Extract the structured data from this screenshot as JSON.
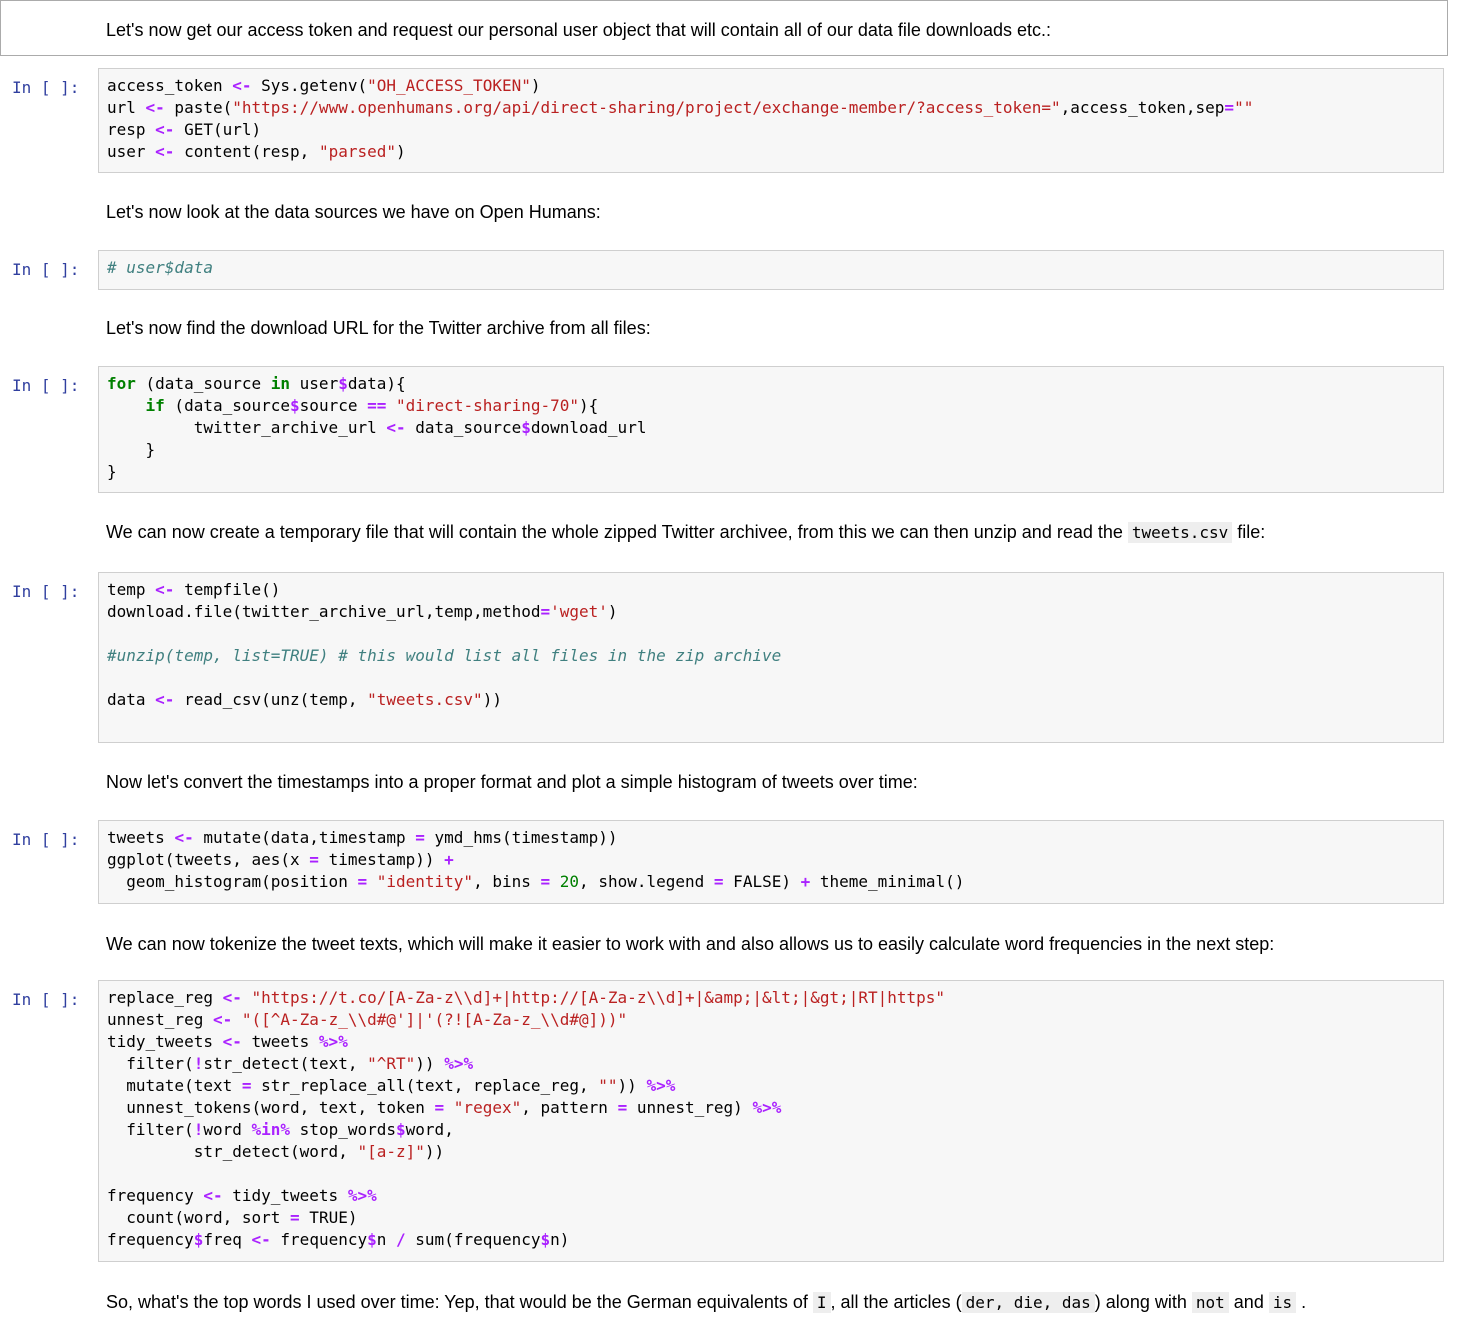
{
  "prompt": "In [ ]:",
  "markdown": {
    "m1": "Let's now get our access token and request our personal user object that will contain all of our data file downloads etc.:",
    "m2": "Let's now look at the data sources we have on Open Humans:",
    "m3": "Let's now find the download URL for the Twitter archive from all files:",
    "m4_a": "We can now create a temporary file that will contain the whole zipped Twitter archivee, from this we can then unzip and read the",
    "m4_code": "tweets.csv",
    "m4_b": "file:",
    "m5": "Now let's convert the timestamps into a proper format and plot a simple histogram of tweets over time:",
    "m6": "We can now tokenize the tweet texts, which will make it easier to work with and also allows us to easily calculate word frequencies in the next step:",
    "m7_a": "So, what's the top words I used over time: Yep, that would be the German equivalents of",
    "m7_c1": "I",
    "m7_b": ", all the articles (",
    "m7_c2": "der, die, das",
    "m7_c": ") along with",
    "m7_c3": "not",
    "m7_d": "and",
    "m7_c4": "is",
    "m7_e": "."
  },
  "cells": [
    {
      "name": "access-token-cell",
      "lines": [
        [
          [
            "t",
            "access_token "
          ],
          [
            "o",
            "<-"
          ],
          [
            "t",
            " Sys.getenv("
          ],
          [
            "s",
            "\"OH_ACCESS_TOKEN\""
          ],
          [
            "t",
            ")"
          ]
        ],
        [
          [
            "t",
            "url "
          ],
          [
            "o",
            "<-"
          ],
          [
            "t",
            " paste("
          ],
          [
            "s",
            "\"https://www.openhumans.org/api/direct-sharing/project/exchange-member/?access_token=\""
          ],
          [
            "t",
            ",access_token,sep"
          ],
          [
            "o",
            "="
          ],
          [
            "s",
            "\"\""
          ]
        ],
        [
          [
            "t",
            "resp "
          ],
          [
            "o",
            "<-"
          ],
          [
            "t",
            " GET(url)"
          ]
        ],
        [
          [
            "t",
            "user "
          ],
          [
            "o",
            "<-"
          ],
          [
            "t",
            " content(resp, "
          ],
          [
            "s",
            "\"parsed\""
          ],
          [
            "t",
            ")"
          ]
        ]
      ]
    },
    {
      "name": "user-data-cell",
      "lines": [
        [
          [
            "c",
            "# user$data"
          ]
        ]
      ]
    },
    {
      "name": "for-loop-cell",
      "lines": [
        [
          [
            "k",
            "for"
          ],
          [
            "t",
            " (data_source "
          ],
          [
            "k",
            "in"
          ],
          [
            "t",
            " user"
          ],
          [
            "o",
            "$"
          ],
          [
            "t",
            "data){"
          ]
        ],
        [
          [
            "t",
            "    "
          ],
          [
            "k",
            "if"
          ],
          [
            "t",
            " (data_source"
          ],
          [
            "o",
            "$"
          ],
          [
            "t",
            "source "
          ],
          [
            "o",
            "=="
          ],
          [
            "t",
            " "
          ],
          [
            "s",
            "\"direct-sharing-70\""
          ],
          [
            "t",
            "){"
          ]
        ],
        [
          [
            "t",
            "         twitter_archive_url "
          ],
          [
            "o",
            "<-"
          ],
          [
            "t",
            " data_source"
          ],
          [
            "o",
            "$"
          ],
          [
            "t",
            "download_url"
          ]
        ],
        [
          [
            "t",
            "    }"
          ]
        ],
        [
          [
            "t",
            "}"
          ]
        ]
      ]
    },
    {
      "name": "tempfile-cell",
      "lines": [
        [
          [
            "t",
            "temp "
          ],
          [
            "o",
            "<-"
          ],
          [
            "t",
            " tempfile()"
          ]
        ],
        [
          [
            "t",
            "download.file(twitter_archive_url,temp,method"
          ],
          [
            "o",
            "="
          ],
          [
            "s",
            "'wget'"
          ],
          [
            "t",
            ")"
          ]
        ],
        [
          [
            "t",
            ""
          ]
        ],
        [
          [
            "c",
            "#unzip(temp, list=TRUE) # this would list all files in the zip archive"
          ]
        ],
        [
          [
            "t",
            ""
          ]
        ],
        [
          [
            "t",
            "data "
          ],
          [
            "o",
            "<-"
          ],
          [
            "t",
            " read_csv(unz(temp, "
          ],
          [
            "s",
            "\"tweets.csv\""
          ],
          [
            "t",
            "))"
          ]
        ],
        [
          [
            "t",
            ""
          ]
        ]
      ]
    },
    {
      "name": "histogram-cell",
      "lines": [
        [
          [
            "t",
            "tweets "
          ],
          [
            "o",
            "<-"
          ],
          [
            "t",
            " mutate(data,timestamp "
          ],
          [
            "o",
            "="
          ],
          [
            "t",
            " ymd_hms(timestamp))"
          ]
        ],
        [
          [
            "t",
            "ggplot(tweets, aes(x "
          ],
          [
            "o",
            "="
          ],
          [
            "t",
            " timestamp)) "
          ],
          [
            "o",
            "+"
          ]
        ],
        [
          [
            "t",
            "  geom_histogram(position "
          ],
          [
            "o",
            "="
          ],
          [
            "t",
            " "
          ],
          [
            "s",
            "\"identity\""
          ],
          [
            "t",
            ", bins "
          ],
          [
            "o",
            "="
          ],
          [
            "t",
            " "
          ],
          [
            "n",
            "20"
          ],
          [
            "t",
            ", show.legend "
          ],
          [
            "o",
            "="
          ],
          [
            "t",
            " FALSE) "
          ],
          [
            "o",
            "+"
          ],
          [
            "t",
            " theme_minimal()"
          ]
        ]
      ]
    },
    {
      "name": "tokenize-cell",
      "lines": [
        [
          [
            "t",
            "replace_reg "
          ],
          [
            "o",
            "<-"
          ],
          [
            "t",
            " "
          ],
          [
            "s",
            "\"https://t.co/[A-Za-z\\\\d]+|http://[A-Za-z\\\\d]+|&amp;|&lt;|&gt;|RT|https\""
          ]
        ],
        [
          [
            "t",
            "unnest_reg "
          ],
          [
            "o",
            "<-"
          ],
          [
            "t",
            " "
          ],
          [
            "s",
            "\"([^A-Za-z_\\\\d#@']|'(?![A-Za-z_\\\\d#@]))\""
          ]
        ],
        [
          [
            "t",
            "tidy_tweets "
          ],
          [
            "o",
            "<-"
          ],
          [
            "t",
            " tweets "
          ],
          [
            "o",
            "%>%"
          ]
        ],
        [
          [
            "t",
            "  filter("
          ],
          [
            "o",
            "!"
          ],
          [
            "t",
            "str_detect(text, "
          ],
          [
            "s",
            "\"^RT\""
          ],
          [
            "t",
            ")) "
          ],
          [
            "o",
            "%>%"
          ]
        ],
        [
          [
            "t",
            "  mutate(text "
          ],
          [
            "o",
            "="
          ],
          [
            "t",
            " str_replace_all(text, replace_reg, "
          ],
          [
            "s",
            "\"\""
          ],
          [
            "t",
            ")) "
          ],
          [
            "o",
            "%>%"
          ]
        ],
        [
          [
            "t",
            "  unnest_tokens(word, text, token "
          ],
          [
            "o",
            "="
          ],
          [
            "t",
            " "
          ],
          [
            "s",
            "\"regex\""
          ],
          [
            "t",
            ", pattern "
          ],
          [
            "o",
            "="
          ],
          [
            "t",
            " unnest_reg) "
          ],
          [
            "o",
            "%>%"
          ]
        ],
        [
          [
            "t",
            "  filter("
          ],
          [
            "o",
            "!"
          ],
          [
            "t",
            "word "
          ],
          [
            "o",
            "%in%"
          ],
          [
            "t",
            " stop_words"
          ],
          [
            "o",
            "$"
          ],
          [
            "t",
            "word,"
          ]
        ],
        [
          [
            "t",
            "         str_detect(word, "
          ],
          [
            "s",
            "\"[a-z]\""
          ],
          [
            "t",
            "))"
          ]
        ],
        [
          [
            "t",
            ""
          ]
        ],
        [
          [
            "t",
            "frequency "
          ],
          [
            "o",
            "<-"
          ],
          [
            "t",
            " tidy_tweets "
          ],
          [
            "o",
            "%>%"
          ]
        ],
        [
          [
            "t",
            "  count(word, sort "
          ],
          [
            "o",
            "="
          ],
          [
            "t",
            " TRUE)"
          ]
        ],
        [
          [
            "t",
            "frequency"
          ],
          [
            "o",
            "$"
          ],
          [
            "t",
            "freq "
          ],
          [
            "o",
            "<-"
          ],
          [
            "t",
            " frequency"
          ],
          [
            "o",
            "$"
          ],
          [
            "t",
            "n "
          ],
          [
            "o",
            "/"
          ],
          [
            "t",
            " sum(frequency"
          ],
          [
            "o",
            "$"
          ],
          [
            "t",
            "n)"
          ]
        ]
      ]
    }
  ]
}
